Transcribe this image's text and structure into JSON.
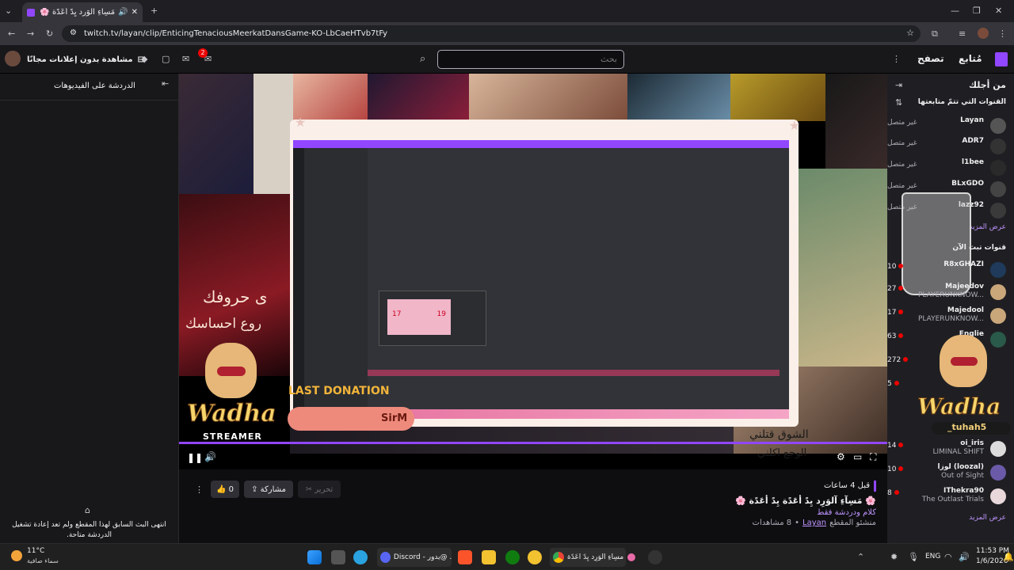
{
  "browser": {
    "tab_title": "مَسِآءِ آلوَرِد يِدً أعَدًة 🌸 ✿",
    "url": "twitch.tv/layan/clip/EnticingTenaciousMeerkatDansGame-KO-LbCaeHTvb7tFy"
  },
  "topnav": {
    "browse": "تصفح",
    "following": "مُتابع",
    "search_placeholder": "بحث",
    "ad_free": "مشاهدة بدون إعلانات مجانًا",
    "notif_count": "2"
  },
  "chat": {
    "header": "الدردشة على الفيديوهات",
    "ended_message": "انتهى البث السابق لهذا المقطع ولم تعد إعادة تشغيل الدردشة متاحة."
  },
  "sidebar": {
    "for_you": "من أجلك",
    "followed_header": "القنوات التي تتمّ متابعتها",
    "offline_label": "غير متصل",
    "followed": [
      {
        "name": "Layan",
        "status": "غير متصل"
      },
      {
        "name": "ADR7",
        "status": "غير متصل"
      },
      {
        "name": "l1bee",
        "status": "غير متصل"
      },
      {
        "name": "BLxGDO",
        "status": "غير متصل"
      },
      {
        "name": "lazz92",
        "status": "غير متصل"
      }
    ],
    "show_more": "عرض المزيد",
    "live_header": "قنوات تبث الآن",
    "live": [
      {
        "name": "R8xGHAZI",
        "game": "",
        "viewers": "10"
      },
      {
        "name": "Majeedov",
        "game": "PLAYERUNKNOW...",
        "viewers": "27"
      },
      {
        "name": "Majedool",
        "game": "PLAYERUNKNOW...",
        "viewers": "17"
      },
      {
        "name": "Englie",
        "game": "",
        "viewers": "63"
      },
      {
        "name": "",
        "game": "",
        "viewers": "272"
      },
      {
        "name": "",
        "game": "",
        "viewers": "5"
      },
      {
        "name": "oi_iris",
        "game": "LIMINAL SHIFT",
        "viewers": "14"
      },
      {
        "name": "لوزا (loozal)",
        "game": "Out of Sight",
        "viewers": "10"
      },
      {
        "name": "IThekra90",
        "game": "The Outlast Trials",
        "viewers": "8"
      }
    ],
    "show_more_2": "عرض المزيد"
  },
  "player": {
    "overlay_logo": "Wadha",
    "overlay_sub": "STREAMER",
    "last_donation": "LAST DONATION",
    "donor": "SirM",
    "tiktok": "_tuhah5",
    "arabic_text_1": "ى حروفك",
    "arabic_text_2": "روع احساسك",
    "arabic_text_3": "الشوق قتلني",
    "arabic_text_4": "الوجع اكلني",
    "discord_card_left": "17",
    "discord_card_right": "19"
  },
  "clip": {
    "time_ago": "قبل 4 ساعات",
    "title": "🌸 مَسِآءِ آلوَرِد يِدً أعَدًة يِدً أعَدًة 🌸",
    "category": "كلام ودردشة فقط",
    "creator_label": "منشئو المقطع",
    "creator": "Layan",
    "views": "8 مشاهدات",
    "likes": "0",
    "share": "مشاركة",
    "edit": "تحرير"
  },
  "taskbar": {
    "weather_temp": "11°C",
    "weather_desc": "سماء صافية",
    "discord_label": "Discord - يدور@ ...",
    "chrome_label": "مسِآءِ آلوَرِد يِدً أعَدًة",
    "lang": "ENG",
    "time": "11:53 PM",
    "date": "1/6/2026"
  }
}
